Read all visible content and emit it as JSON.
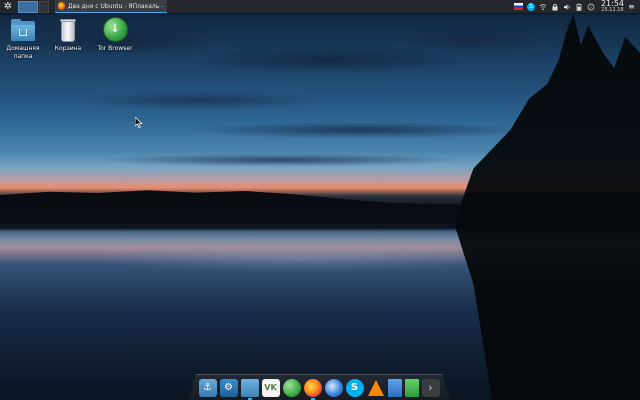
{
  "top_panel": {
    "app_menu_icon": "kde-logo-icon",
    "task_title": "Два дня с Ubuntu - ЯПлакаль - Mo...",
    "task_icon": "firefox-icon",
    "tray": {
      "language_flag": "ru-flag-icon",
      "icons": [
        "skype-icon",
        "network-icon",
        "vpn-lock-icon",
        "volume-icon",
        "battery-icon",
        "notifications-icon"
      ],
      "time": "21:54",
      "date": "25.12.18"
    }
  },
  "desktop_icons": [
    {
      "label_line1": "Домашняя",
      "label_line2": "папка",
      "icon": "home-folder-icon"
    },
    {
      "label_line1": "Корзина",
      "label_line2": "",
      "icon": "trash-icon"
    },
    {
      "label_line1": "Tor Browser",
      "label_line2": "",
      "icon": "tor-browser-icon"
    }
  ],
  "dock": {
    "items": [
      "anchor-icon",
      "settings-icon",
      "file-manager-icon",
      "vk-icon",
      "tor-browser-icon",
      "firefox-icon",
      "thunderbird-icon",
      "skype-icon",
      "vlc-icon",
      "document-icon",
      "spreadsheet-icon",
      "more-arrow-icon"
    ],
    "vk_text": "VK",
    "skype_text": "S",
    "more_text": "›"
  },
  "colors": {
    "panel_bg": "#23262b",
    "accent": "#3daee9"
  }
}
